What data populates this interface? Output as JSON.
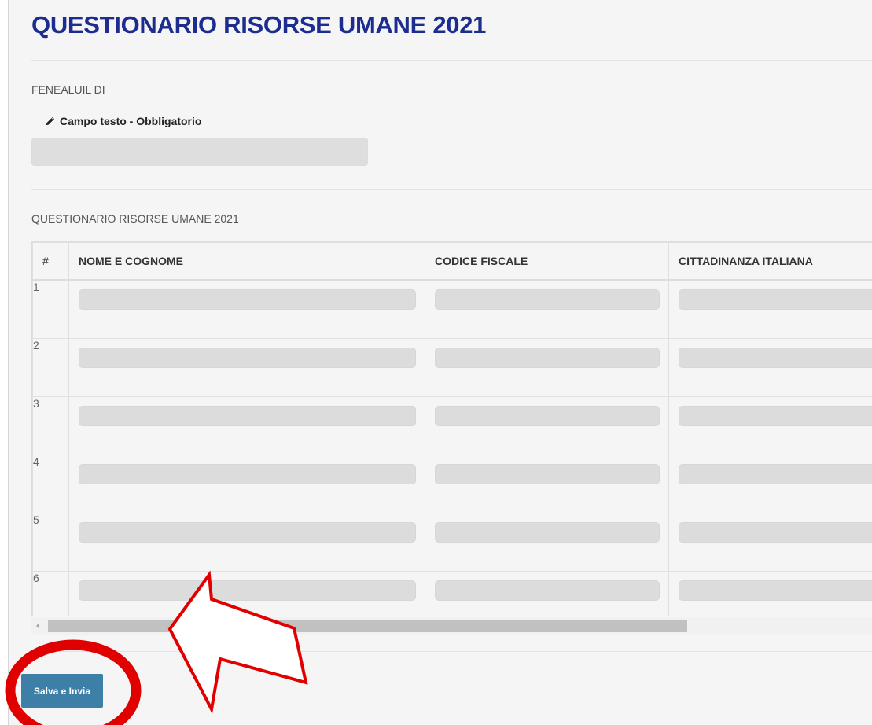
{
  "title": "QUESTIONARIO RISORSE UMANE 2021",
  "section1": {
    "label": "FENEALUIL DI",
    "field_label": "Campo testo - Obbligatorio",
    "field_value": ""
  },
  "section2": {
    "label": "QUESTIONARIO RISORSE UMANE 2021"
  },
  "table": {
    "headers": [
      "#",
      "NOME E COGNOME",
      "CODICE FISCALE",
      "CITTADINANZA ITALIANA"
    ],
    "rows": [
      "1",
      "2",
      "3",
      "4",
      "5",
      "6"
    ]
  },
  "submit_label": "Salva e Invia",
  "colors": {
    "title": "#1d2d8f",
    "button": "#3d7fa6",
    "annotation": "#e00000"
  },
  "icons": [
    "pencil-icon",
    "scroll-left-icon"
  ]
}
